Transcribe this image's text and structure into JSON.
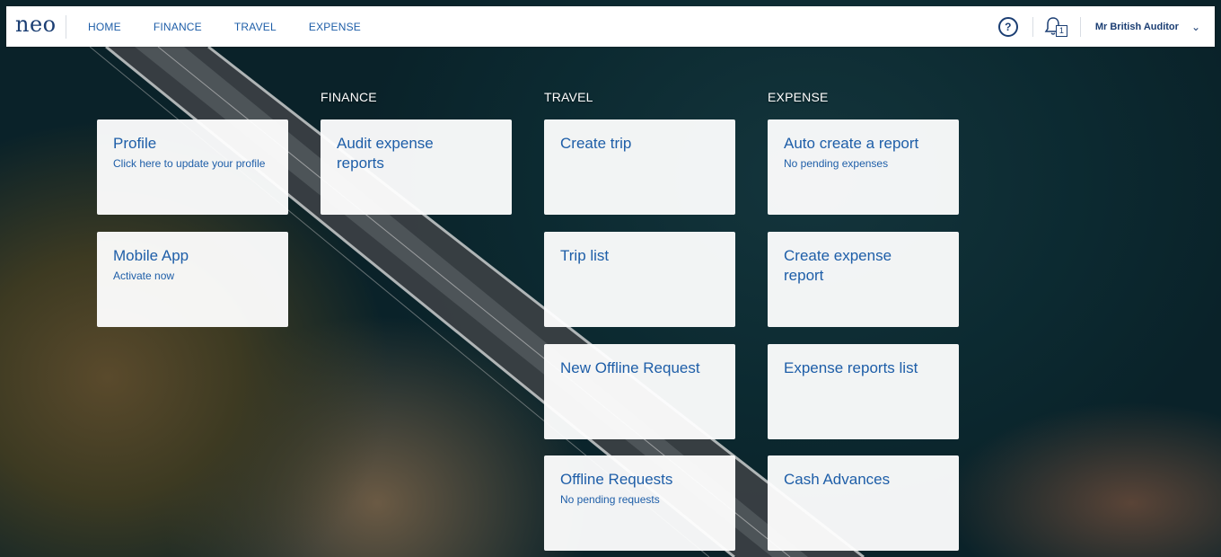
{
  "nav": {
    "logo": "neo",
    "items": [
      "HOME",
      "FINANCE",
      "TRAVEL",
      "EXPENSE"
    ],
    "notifications_count": "1",
    "user_name": "Mr British Auditor"
  },
  "columns": {
    "finance": "FINANCE",
    "travel": "TRAVEL",
    "expense": "EXPENSE"
  },
  "tiles": {
    "profile": {
      "title": "Profile",
      "subtitle": "Click here to update your profile"
    },
    "mobile_app": {
      "title": "Mobile App",
      "subtitle": "Activate now"
    },
    "audit_expense_reports": {
      "title": "Audit expense reports"
    },
    "create_trip": {
      "title": "Create trip"
    },
    "trip_list": {
      "title": "Trip list"
    },
    "new_offline_request": {
      "title": "New Offline Request"
    },
    "offline_requests": {
      "title": "Offline Requests",
      "subtitle": "No pending requests"
    },
    "auto_create_report": {
      "title": "Auto create a report",
      "subtitle": "No pending expenses"
    },
    "create_expense_report": {
      "title": "Create expense report"
    },
    "expense_reports_list": {
      "title": "Expense reports list"
    },
    "cash_advances": {
      "title": "Cash Advances"
    }
  },
  "colors": {
    "brand": "#1b3e73",
    "link": "#1e5ea8",
    "tile_bg": "#ffffff"
  },
  "icons": [
    "help-icon",
    "bell-icon",
    "chevron-down-icon"
  ]
}
